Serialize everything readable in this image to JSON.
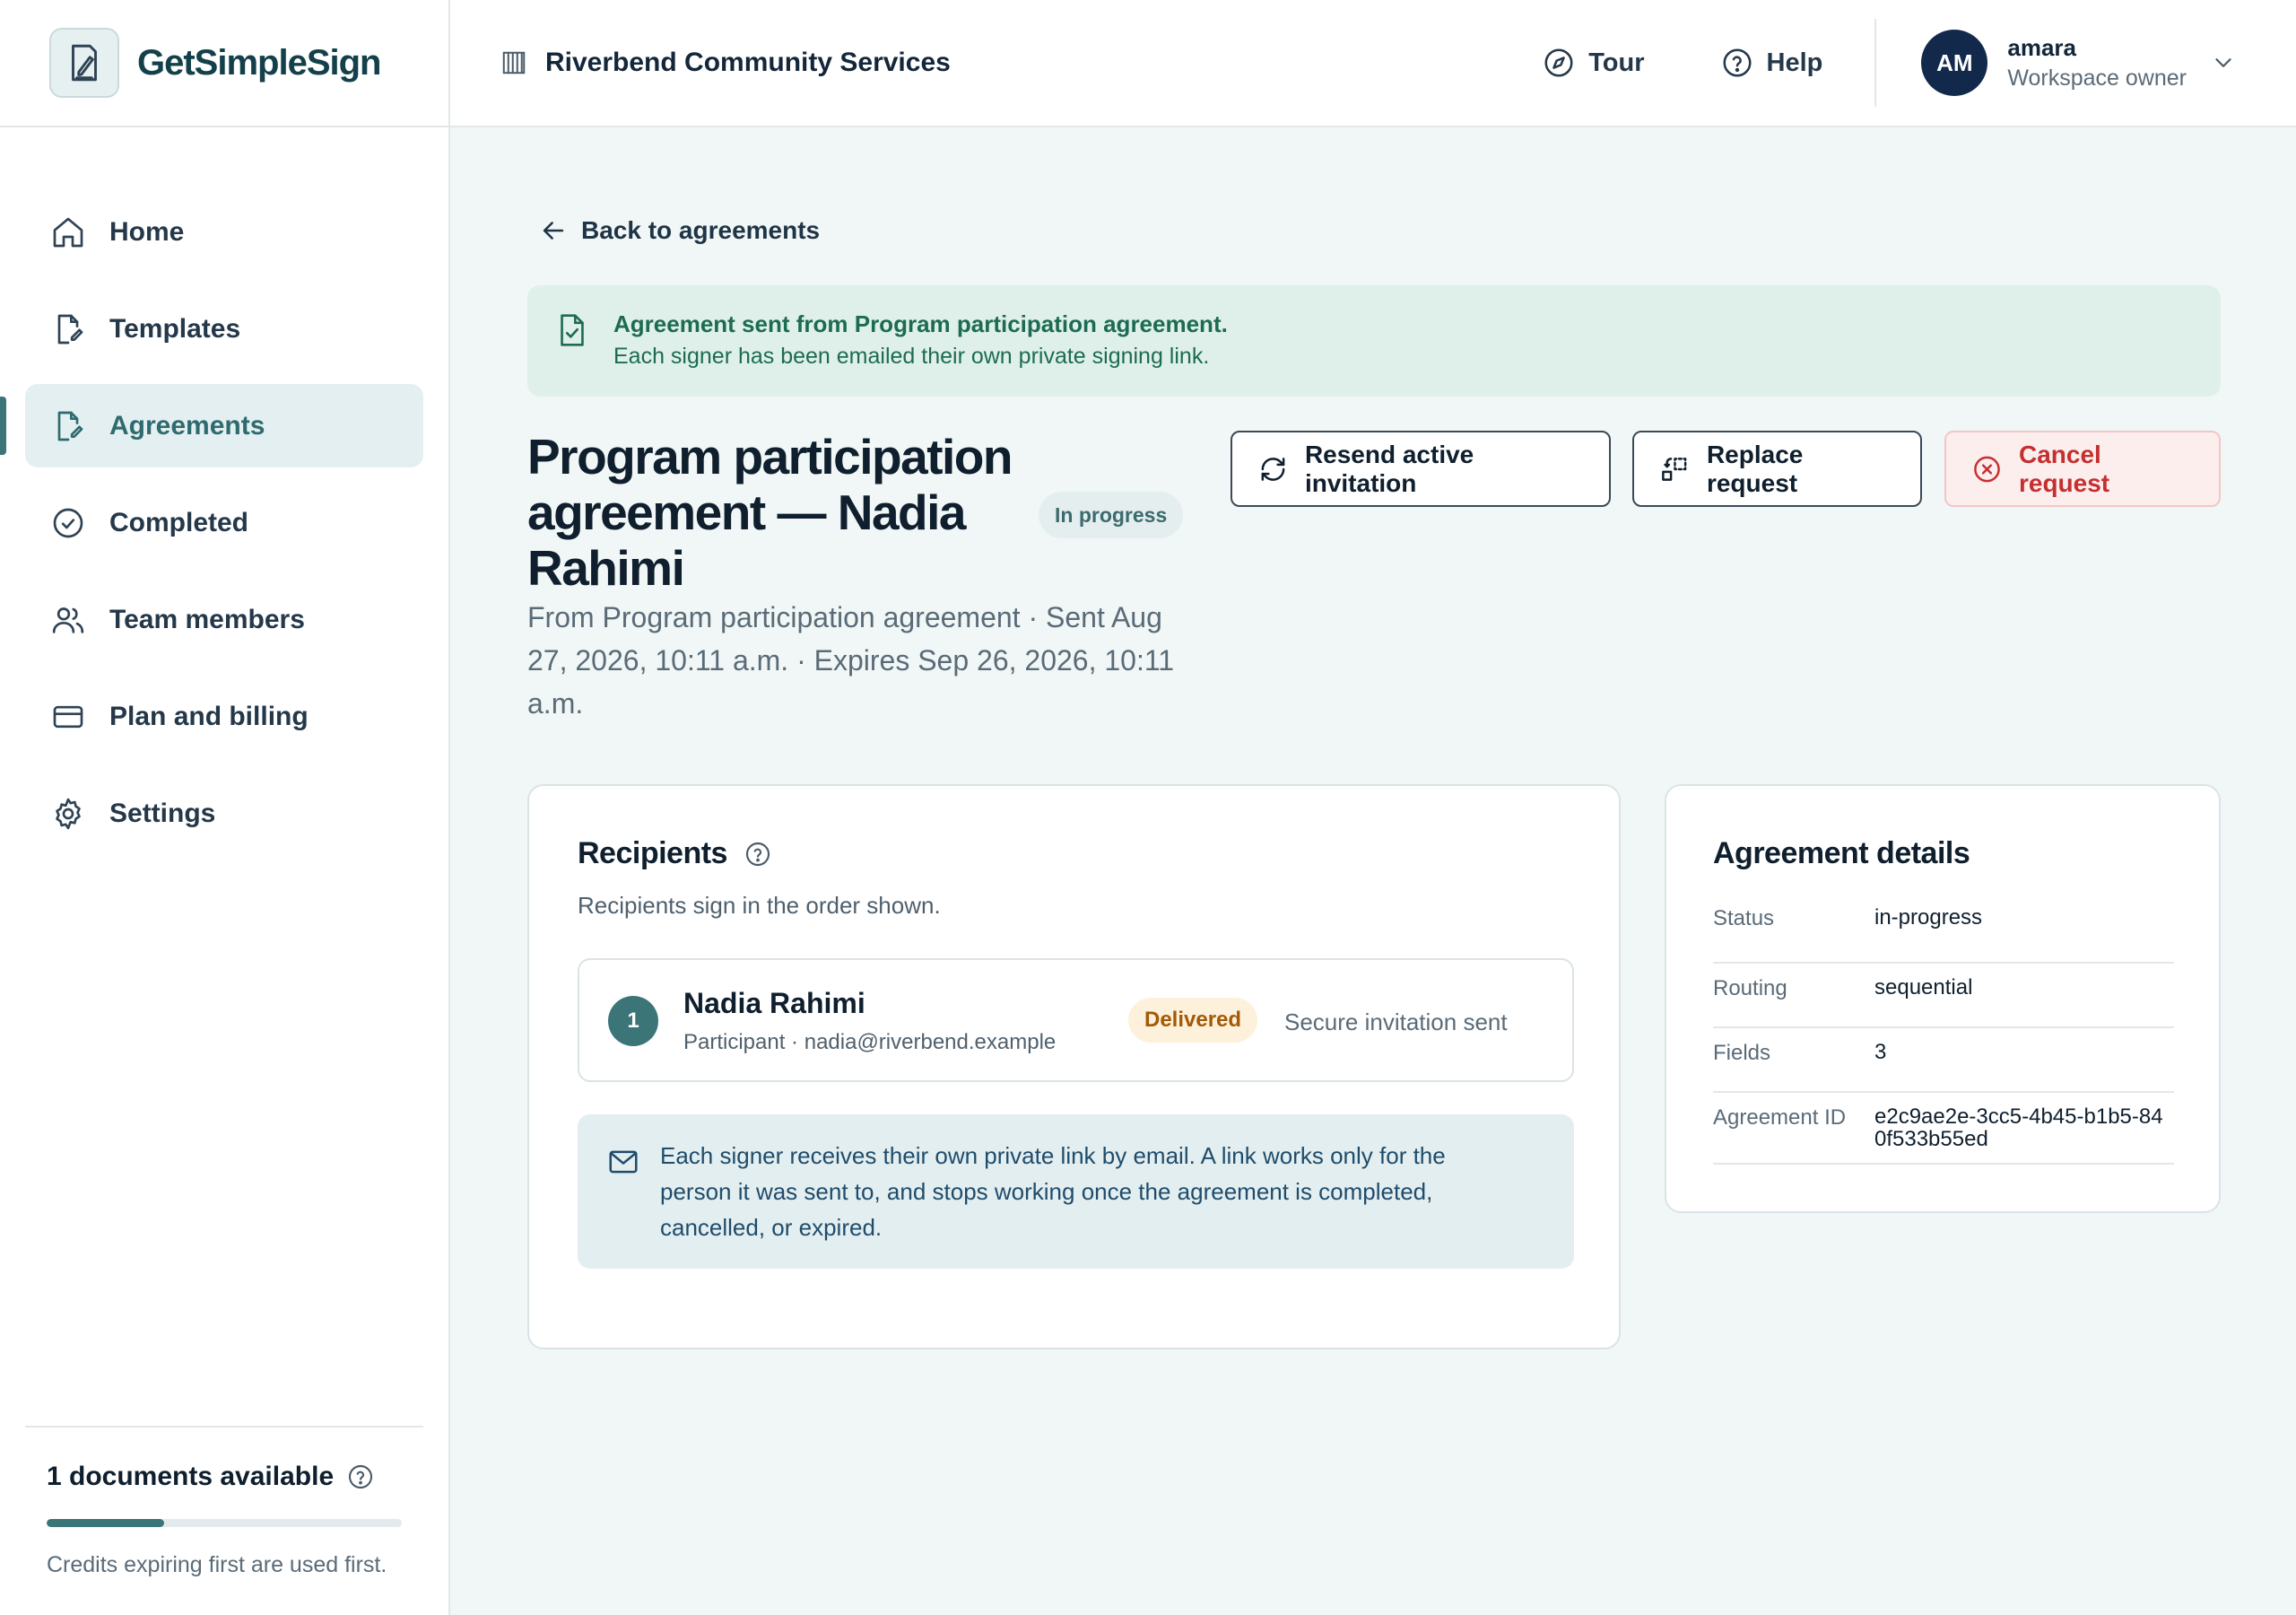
{
  "app": {
    "name": "GetSimpleSign"
  },
  "sidebar": {
    "items": [
      {
        "label": "Home",
        "icon": "home-icon",
        "active": false
      },
      {
        "label": "Templates",
        "icon": "template-icon",
        "active": false
      },
      {
        "label": "Agreements",
        "icon": "agreement-icon",
        "active": true
      },
      {
        "label": "Completed",
        "icon": "check-circle-icon",
        "active": false
      },
      {
        "label": "Team members",
        "icon": "users-icon",
        "active": false
      },
      {
        "label": "Plan and billing",
        "icon": "credit-card-icon",
        "active": false
      },
      {
        "label": "Settings",
        "icon": "gear-icon",
        "active": false
      }
    ],
    "credits": {
      "title": "1 documents available",
      "note": "Credits expiring first are used first.",
      "progress_fraction": 0.33
    }
  },
  "header": {
    "org_name": "Riverbend Community Services",
    "tour_label": "Tour",
    "help_label": "Help",
    "user": {
      "initials": "AM",
      "name": "amara",
      "role": "Workspace owner"
    }
  },
  "main": {
    "back_label": "Back to agreements",
    "banner": {
      "title": "Agreement sent from Program participation agreement.",
      "subtitle": "Each signer has been emailed their own private signing link."
    },
    "title": "Program participation agreement — Nadia Rahimi",
    "status_pill": "In progress",
    "meta": "From Program participation agreement · Sent Aug 27, 2026, 10:11 a.m. · Expires Sep 26, 2026, 10:11 a.m.",
    "actions": {
      "resend": "Resend active invitation",
      "replace": "Replace request",
      "cancel": "Cancel request"
    },
    "recipients": {
      "heading": "Recipients",
      "note": "Recipients sign in the order shown.",
      "signers": [
        {
          "order": "1",
          "name": "Nadia Rahimi",
          "subtitle": "Participant · nadia@riverbend.example",
          "badge": "Delivered",
          "state": "Secure invitation sent"
        }
      ],
      "info": "Each signer receives their own private link by email. A link works only for the person it was sent to, and stops working once the agreement is completed, cancelled, or expired."
    },
    "details": {
      "heading": "Agreement details",
      "rows": [
        {
          "label": "Status",
          "value": "in-progress"
        },
        {
          "label": "Routing",
          "value": "sequential"
        },
        {
          "label": "Fields",
          "value": "3"
        },
        {
          "label": "Agreement ID",
          "value": "e2c9ae2e-3cc5-4b45-b1b5-840f533b55ed"
        }
      ]
    }
  },
  "colors": {
    "accent": "#3b7577",
    "navy": "#13294b",
    "success": "#1d6b53",
    "danger": "#c62f2f",
    "warning_badge": "#a35a06"
  }
}
